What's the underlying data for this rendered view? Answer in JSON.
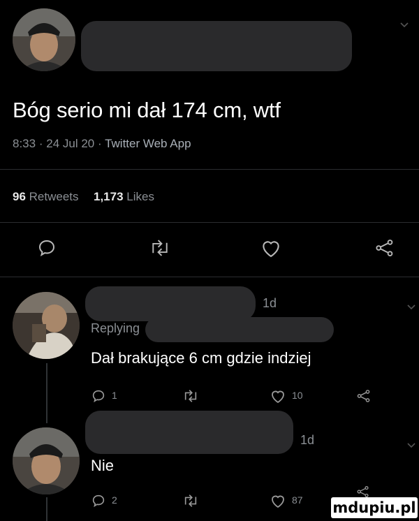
{
  "main_tweet": {
    "text": "Bóg serio mi dał 174 cm, wtf",
    "time": "8:33",
    "date": "24 Jul 20",
    "sep": "·",
    "source": "Twitter Web App",
    "retweets_count": "96",
    "retweets_label": "Retweets",
    "likes_count": "1,173",
    "likes_label": "Likes"
  },
  "replies": [
    {
      "age": "1d",
      "replying_label": "Replying",
      "text": "Dał brakujące 6 cm gdzie indziej",
      "reply_count": "1",
      "like_count": "10"
    },
    {
      "age": "1d",
      "text": "Nie",
      "reply_count": "2",
      "like_count": "87"
    }
  ],
  "watermark": "mdupiu.pl",
  "colors": {
    "background": "#000000",
    "muted_text": "#8b8f94",
    "redaction": "#2a2a2c",
    "icon": "#b8b8b8"
  },
  "icons": [
    "reply-icon",
    "retweet-icon",
    "like-icon",
    "share-icon",
    "chevron-down-icon"
  ]
}
